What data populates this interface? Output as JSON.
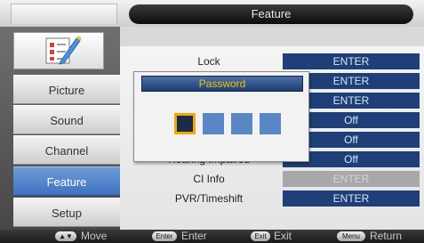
{
  "header": {
    "title": "Feature"
  },
  "sidebar": {
    "icon": "checklist-pencil-icon",
    "items": [
      {
        "label": "Picture"
      },
      {
        "label": "Sound"
      },
      {
        "label": "Channel"
      },
      {
        "label": "Feature",
        "active": true
      },
      {
        "label": "Setup"
      }
    ]
  },
  "content": {
    "rows": [
      {
        "label": "Lock",
        "value": "ENTER"
      },
      {
        "label": "",
        "value": "ENTER"
      },
      {
        "label": "",
        "value": "ENTER"
      },
      {
        "label": "",
        "value": "Off"
      },
      {
        "label": "",
        "value": "Off"
      },
      {
        "label": "Hearing Impaired",
        "value": "Off"
      },
      {
        "label": "CI Info",
        "value": "ENTER",
        "disabled": true
      },
      {
        "label": "PVR/Timeshift",
        "value": "ENTER"
      }
    ]
  },
  "dialog": {
    "title": "Password",
    "digits": 4,
    "focused_index": 0
  },
  "bottom_bar": {
    "hints": [
      {
        "key": "▲▼",
        "label": "Move"
      },
      {
        "key": "Enter",
        "label": "Enter"
      },
      {
        "key": "Exit",
        "label": "Exit"
      },
      {
        "key": "Menu",
        "label": "Return"
      }
    ]
  },
  "colors": {
    "accent": "#3f72c1",
    "value_bg": "#1e3f77",
    "dialog_title_text": "#f2c200",
    "focus_border": "#f2a800"
  }
}
